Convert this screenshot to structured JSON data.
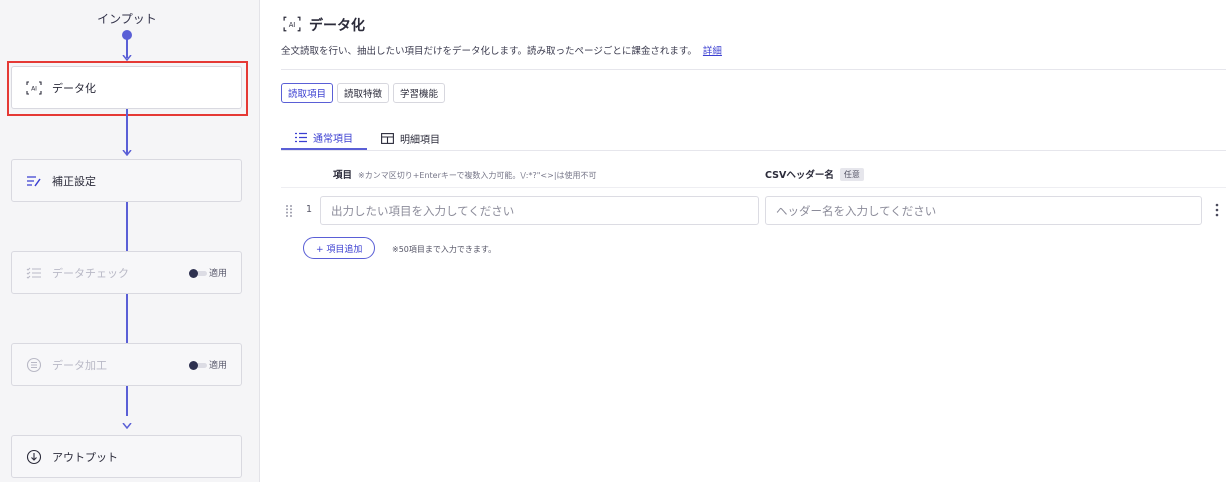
{
  "flow": {
    "input_label": "インプット",
    "nodes": [
      {
        "label": "データ化",
        "icon": "ai-icon"
      },
      {
        "label": "補正設定",
        "icon": "list-edit-icon"
      },
      {
        "label": "データチェック",
        "icon": "checklist-icon",
        "toggle_label": "適用"
      },
      {
        "label": "データ加工",
        "icon": "list-circle-icon",
        "toggle_label": "適用"
      },
      {
        "label": "アウトプット",
        "icon": "download-circle-icon"
      }
    ]
  },
  "header": {
    "title": "データ化",
    "description": "全文読取を行い、抽出したい項目だけをデータ化します。読み取ったページごとに課金されます。",
    "detail_link": "詳細"
  },
  "chips": [
    "読取項目",
    "読取特徴",
    "学習機能"
  ],
  "tabs": [
    "通常項目",
    "明細項目"
  ],
  "columns": {
    "item": "項目",
    "item_note": "※カンマ区切り+Enterキーで複数入力可能。\\/:*?\"<>|は使用不可",
    "csv": "CSVヘッダー名",
    "optional_badge": "任意"
  },
  "row": {
    "number": "1",
    "item_placeholder": "出力したい項目を入力してください",
    "header_placeholder": "ヘッダー名を入力してください"
  },
  "add": {
    "button": "+ 項目追加",
    "note": "※50項目まで入力できます。"
  },
  "colors": {
    "accent": "#5a5fd6",
    "selection": "#e53935"
  }
}
